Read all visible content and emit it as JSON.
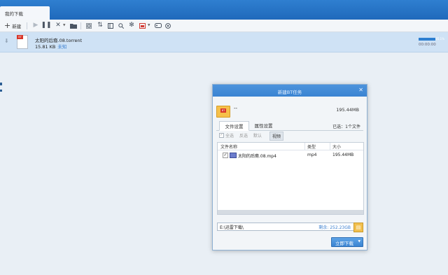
{
  "app": {
    "tab_label": "我的下载",
    "accent": "#2f7fd0"
  },
  "toolbar": {
    "new_label": "新建",
    "icons": [
      "start-icon",
      "pause-icon",
      "delete-icon",
      "folder-icon",
      "grid-icon",
      "sort-icon",
      "details-icon",
      "search-icon",
      "settings-icon",
      "store-icon",
      "gamepad-icon",
      "network-icon"
    ]
  },
  "task": {
    "file_name": "太阳的后裔.08.torrent",
    "file_size": "15.81 KB",
    "status": "未知",
    "progress_text": "65.1%",
    "progress": 0.651,
    "time": "00:00:00"
  },
  "dialog": {
    "title": "新建BT任务",
    "name_value": "--",
    "total_size": "195.44MB",
    "tabs": [
      "文件设置",
      "属性设置"
    ],
    "selected_text": "已选：1个文件",
    "filters": [
      "全选",
      "反选",
      "默认",
      "视频"
    ],
    "columns": [
      "文件名称",
      "类型",
      "大小"
    ],
    "files": [
      {
        "name": "太阳的后裔.08.mp4",
        "type": "mp4",
        "size": "195.44MB"
      }
    ],
    "path": "E:\\迅雷下载\\",
    "free_space": "剩余: 252.23GB",
    "start_button": "立即下载"
  }
}
